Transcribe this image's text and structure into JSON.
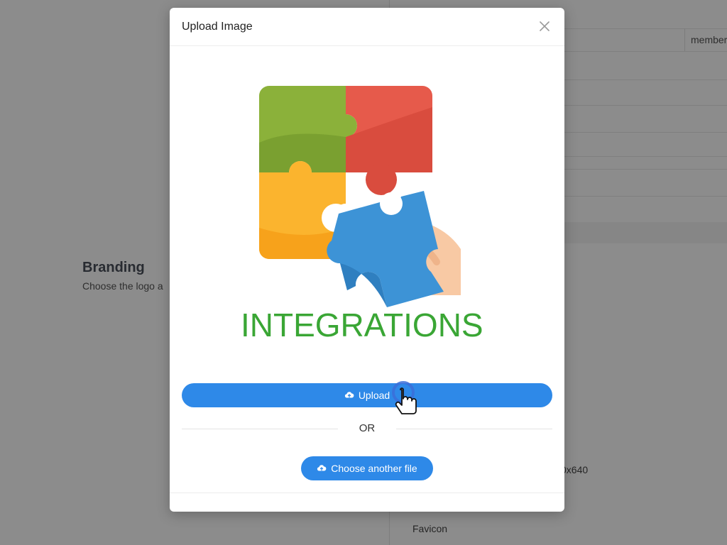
{
  "background": {
    "table_header_cell": "member",
    "branding": {
      "title": "Branding",
      "subtitle": "Choose the logo a"
    },
    "dimension_text": "0x640",
    "favicon_label": "Favicon"
  },
  "modal": {
    "title": "Upload Image",
    "close_icon": "close-icon",
    "preview_caption": "INTEGRATIONS",
    "upload_button": {
      "label": "Upload",
      "icon": "cloud-upload-icon"
    },
    "divider_text": "OR",
    "choose_button": {
      "label": "Choose another file",
      "icon": "cloud-upload-icon"
    }
  },
  "colors": {
    "primary": "#2e89e8",
    "caption": "#3aa635",
    "overlay": "rgba(0,0,0,0.45)"
  }
}
